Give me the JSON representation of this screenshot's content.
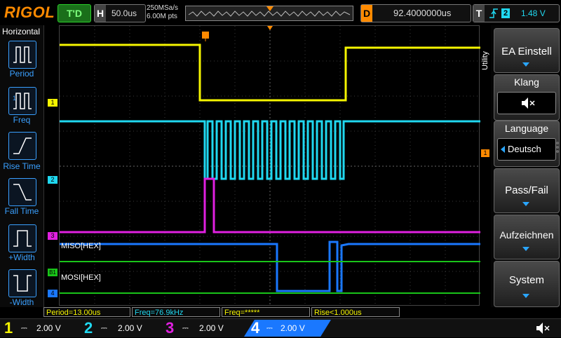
{
  "topbar": {
    "brand": "RIGOL",
    "run_state": "T'D",
    "timebase_label": "H",
    "timebase_value": "50.0us",
    "sample_rate": "250MSa/s",
    "memory_depth": "6.00M pts",
    "delay_label": "D",
    "delay_value": "92.4000000us",
    "trigger_label": "T",
    "trigger_source": "2",
    "trigger_level": "1.48 V"
  },
  "left_panel": {
    "title": "Horizontal",
    "items": [
      {
        "label": "Period"
      },
      {
        "label": "Freq"
      },
      {
        "label": "Rise Time"
      },
      {
        "label": "Fall Time"
      },
      {
        "label": "+Width"
      },
      {
        "label": "-Width"
      }
    ]
  },
  "waveform": {
    "decode_labels": [
      "MISO[HEX]",
      "MOSI[HEX]"
    ],
    "channel_markers": [
      "1",
      "2",
      "3",
      "B1",
      "4"
    ],
    "colors": {
      "ch1": "#f5f500",
      "ch2": "#20d8f0",
      "ch3": "#e020e0",
      "ch4": "#1a78ff",
      "bus": "#19c419",
      "accent": "#ff8a00"
    }
  },
  "right_menu": {
    "side_label": "Utility",
    "items": [
      {
        "label": "EA Einstell"
      },
      {
        "label": "Klang"
      },
      {
        "label": "Language",
        "value": "Deutsch"
      },
      {
        "label": "Pass/Fail"
      },
      {
        "label": "Aufzeichnen"
      },
      {
        "label": "System"
      }
    ]
  },
  "measurements": [
    {
      "text": "Period=13.00us"
    },
    {
      "text": "Freq=76.9kHz"
    },
    {
      "text": "Freq=*****"
    },
    {
      "text": "Rise<1.000us"
    }
  ],
  "channels": [
    {
      "num": "1",
      "scale": "2.00 V",
      "color": "#f5f500"
    },
    {
      "num": "2",
      "scale": "2.00 V",
      "color": "#20d8f0"
    },
    {
      "num": "3",
      "scale": "2.00 V",
      "color": "#e020e0"
    },
    {
      "num": "4",
      "scale": "2.00 V",
      "color": "#1a78ff"
    }
  ]
}
